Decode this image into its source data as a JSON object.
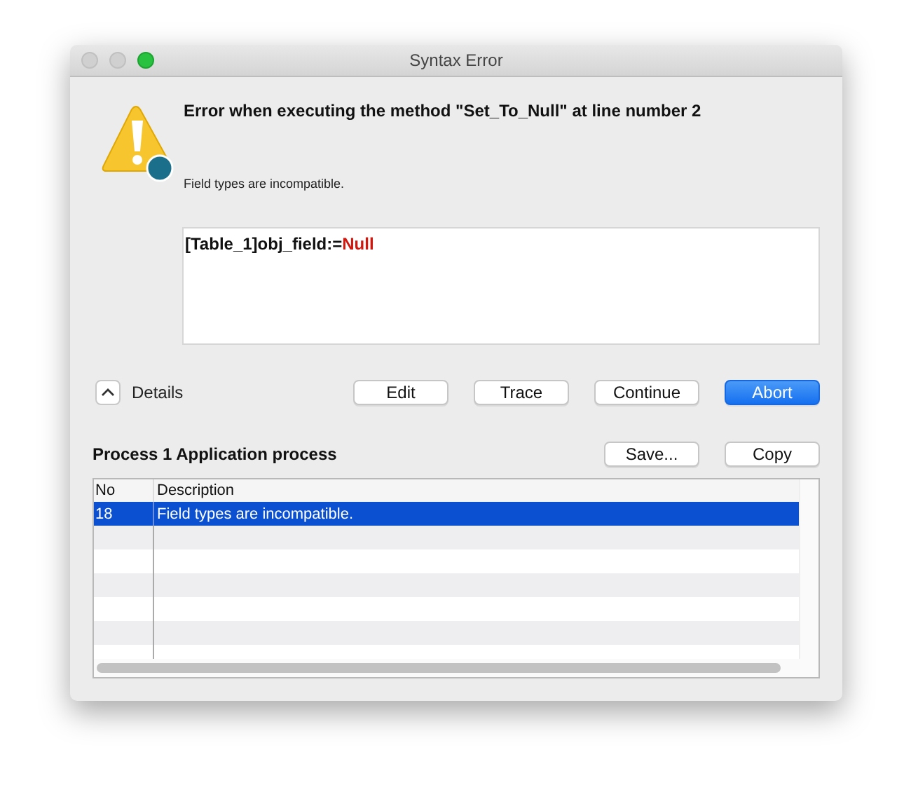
{
  "window": {
    "title": "Syntax Error"
  },
  "error": {
    "heading": "Error when executing the method \"Set_To_Null\" at line number 2",
    "message": "Field types are incompatible."
  },
  "code": [
    {
      "kind": "plain",
      "text": "[Table_1]obj_field:="
    },
    {
      "kind": "keyword",
      "text": "Null"
    }
  ],
  "details": {
    "label": "Details",
    "expanded": true
  },
  "buttons": [
    {
      "label": "Edit",
      "default": false
    },
    {
      "label": "Trace",
      "default": false
    },
    {
      "label": "Continue",
      "default": false
    },
    {
      "label": "Abort",
      "default": true
    }
  ],
  "process": {
    "label": "Process 1 Application process",
    "buttons": [
      "Save...",
      "Copy"
    ]
  },
  "table": {
    "columns": [
      "No",
      "Description"
    ],
    "rows": [
      {
        "no": "18",
        "description": "Field types are incompatible.",
        "selected": true
      }
    ]
  }
}
